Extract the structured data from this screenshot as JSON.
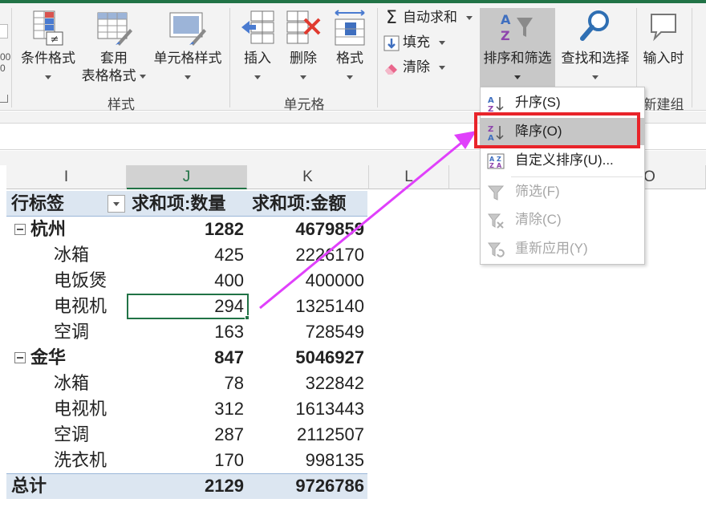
{
  "ribbon": {
    "left_clip": {
      "mark1": "00",
      "mark2": "0"
    },
    "styles_group": {
      "label": "样式",
      "conditional_format": "条件格式",
      "table_format_line1": "套用",
      "table_format_line2": "表格格式",
      "cell_styles": "单元格样式"
    },
    "cells_group": {
      "label": "单元格",
      "insert": "插入",
      "delete": "删除",
      "format": "格式"
    },
    "editing_group": {
      "autosum": "自动求和",
      "fill": "填充",
      "clear": "清除",
      "sort_filter": "排序和筛选",
      "find_select": "查找和选择"
    },
    "new_group": {
      "label": "新建组",
      "input_time": "输入时"
    }
  },
  "columns": [
    "I",
    "J",
    "K",
    "L",
    "O"
  ],
  "pivot": {
    "header": {
      "row_label": "行标签",
      "col_qty": "求和项:数量",
      "col_amount": "求和项:金额"
    },
    "rows": [
      {
        "label": "杭州",
        "qty": "1282",
        "amount": "4679859",
        "group": true
      },
      {
        "label": "冰箱",
        "qty": "425",
        "amount": "2226170",
        "group": false
      },
      {
        "label": "电饭煲",
        "qty": "400",
        "amount": "400000",
        "group": false
      },
      {
        "label": "电视机",
        "qty": "294",
        "amount": "1325140",
        "group": false
      },
      {
        "label": "空调",
        "qty": "163",
        "amount": "728549",
        "group": false
      },
      {
        "label": "金华",
        "qty": "847",
        "amount": "5046927",
        "group": true
      },
      {
        "label": "冰箱",
        "qty": "78",
        "amount": "322842",
        "group": false
      },
      {
        "label": "电视机",
        "qty": "312",
        "amount": "1613443",
        "group": false
      },
      {
        "label": "空调",
        "qty": "287",
        "amount": "2112507",
        "group": false
      },
      {
        "label": "洗衣机",
        "qty": "170",
        "amount": "998135",
        "group": false
      }
    ],
    "total": {
      "label": "总计",
      "qty": "2129",
      "amount": "9726786"
    }
  },
  "sort_menu": {
    "items": [
      {
        "label": "升序(S)",
        "icon": "sort-ascending-icon",
        "enabled": true
      },
      {
        "label": "降序(O)",
        "icon": "sort-descending-icon",
        "enabled": true,
        "highlighted": true
      },
      {
        "label": "自定义排序(U)...",
        "icon": "custom-sort-icon",
        "enabled": true
      },
      {
        "label": "筛选(F)",
        "icon": "filter-icon",
        "enabled": false
      },
      {
        "label": "清除(C)",
        "icon": "clear-filter-icon",
        "enabled": false
      },
      {
        "label": "重新应用(Y)",
        "icon": "reapply-icon",
        "enabled": false
      }
    ]
  },
  "colors": {
    "excel_green": "#217346",
    "pivot_header_fill": "#dce6f1",
    "annotation_red": "#e8242a",
    "annotation_arrow": "#e040fb"
  }
}
